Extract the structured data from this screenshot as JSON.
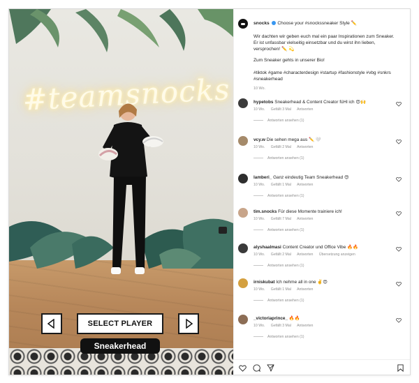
{
  "post": {
    "account": "snocks",
    "caption_intro": "Choose your #snockssneaker Style ✏️",
    "caption_paragraph": "Wir dachten wir geben euch mal ein paar Inspirationen zum Sneaker. Er ist unfassbar vielseitig einsetzbar und du wirst ihn lieben, versprochen! ✏️ 💫",
    "caption_bio": "Zum Sneaker gehts in unserer Bio!",
    "hashtags": "#tiktok #game #characterdesign #startup #fashionstyle #vbg #snkrs #sneakerhead",
    "time": "10 Wo.",
    "neon_sign": "#teamsnocks"
  },
  "game_ui": {
    "select_label": "SELECT PLAYER",
    "player_name": "Sneakerhead"
  },
  "comments": [
    {
      "user": "hypetobs",
      "text": "Sneakerhead & Content Creator füHl ich",
      "emoji": "😍🙌",
      "time": "10 Wo.",
      "likes": "Gefällt 3 Mal",
      "reply": "Antworten",
      "extra": "",
      "replies": "Antworten ansehen (1)"
    },
    {
      "user": "vcy.w",
      "text": "Die sehen mega aus ✏️",
      "emoji": "🤍",
      "time": "10 Wo.",
      "likes": "Gefällt 2 Mal",
      "reply": "Antworten",
      "extra": "",
      "replies": "Antworten ansehen (1)"
    },
    {
      "user": "lamberi_",
      "text": "Ganz eindeutig Team Sneakerhead",
      "emoji": "😍",
      "time": "10 Wo.",
      "likes": "Gefällt 1 Mal",
      "reply": "Antworten",
      "extra": "",
      "replies": "Antworten ansehen (1)"
    },
    {
      "user": "tim.snocks",
      "text": "Für diese Momente trainiere ich!",
      "emoji": "",
      "time": "10 Wo.",
      "likes": "Gefällt 7 Mal",
      "reply": "Antworten",
      "extra": "",
      "replies": "Antworten ansehen (1)"
    },
    {
      "user": "alyshaalmasi",
      "text": "Content Creator und Office Vibe",
      "emoji": "🔥🔥",
      "time": "10 Wo.",
      "likes": "Gefällt 2 Mal",
      "reply": "Antworten",
      "extra": "Übersetzung anzeigen",
      "replies": "Antworten ansehen (1)"
    },
    {
      "user": "irniskubat",
      "text": "Ich nehme all in one",
      "emoji": "✌️😍",
      "time": "10 Wo.",
      "likes": "Gefällt 1 Mal",
      "reply": "Antworten",
      "extra": "",
      "replies": "Antworten ansehen (1)"
    },
    {
      "user": "_victoriaprince_",
      "text": "",
      "emoji": "🔥🔥",
      "time": "10 Wo.",
      "likes": "Gefällt 3 Mal",
      "reply": "Antworten",
      "extra": "",
      "replies": "Antworten ansehen (1)"
    }
  ],
  "colors": {
    "link": "#00376b",
    "muted": "#8e8e8e",
    "verified": "#3897f0",
    "border": "#dbdbdb"
  },
  "icons": {
    "like": "heart-icon",
    "comment": "comment-icon",
    "share": "share-icon",
    "save": "bookmark-icon",
    "prev": "triangle-left-icon",
    "next": "triangle-right-icon"
  }
}
